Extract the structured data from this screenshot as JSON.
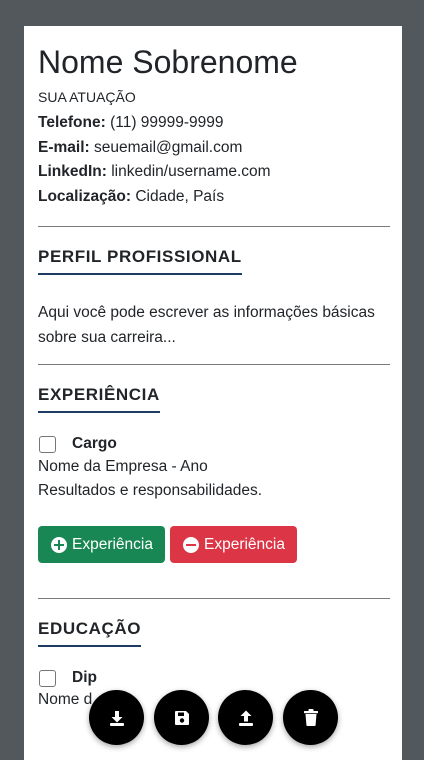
{
  "header": {
    "name": "Nome Sobrenome",
    "role": "SUA ATUAÇÃO"
  },
  "contact": [
    {
      "label": "Telefone:",
      "value": "(11) 99999-9999"
    },
    {
      "label": "E-mail:",
      "value": "seuemail@gmail.com"
    },
    {
      "label": "LinkedIn:",
      "value": "linkedin/username.com"
    },
    {
      "label": "Localização:",
      "value": "Cidade, País"
    }
  ],
  "profile": {
    "title": "PERFIL PROFISSIONAL",
    "text": "Aqui você pode escrever as informações básicas sobre sua carreira..."
  },
  "experience": {
    "title": "EXPERIÊNCIA",
    "item": {
      "cargo": "Cargo",
      "company": "Nome da Empresa - Ano",
      "details": "Resultados e responsabilidades."
    },
    "add_label": "Experiência",
    "remove_label": "Experiência"
  },
  "education": {
    "title": "EDUCAÇÃO",
    "item": {
      "degree_visible": "Dip",
      "institution_visible": "Nome d"
    }
  },
  "fab_icons": [
    "download-icon",
    "save-icon",
    "upload-icon",
    "trash-icon"
  ],
  "colors": {
    "add": "#198754",
    "remove": "#dc3545",
    "underline": "#1f3b63",
    "backdrop": "#53585d"
  }
}
